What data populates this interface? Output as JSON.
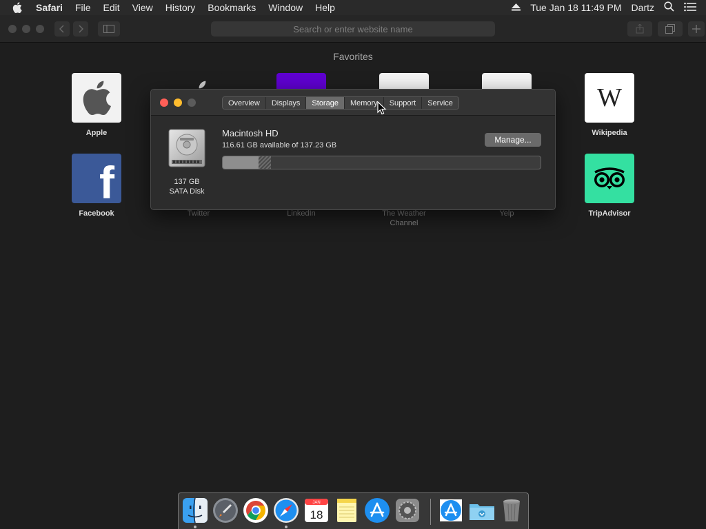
{
  "menubar": {
    "app_name": "Safari",
    "items": [
      "File",
      "Edit",
      "View",
      "History",
      "Bookmarks",
      "Window",
      "Help"
    ],
    "datetime": "Tue Jan 18  11:49 PM",
    "user": "Dartz"
  },
  "toolbar": {
    "address_placeholder": "Search or enter website name"
  },
  "favorites": {
    "heading": "Favorites",
    "items": [
      {
        "label": "Apple",
        "icon": "apple-logo-icon"
      },
      {
        "label": "Wikipedia",
        "icon": "wikipedia-w-icon"
      },
      {
        "label": "Facebook",
        "icon": "facebook-f-icon"
      },
      {
        "label": "Twitter",
        "icon": "twitter-icon"
      },
      {
        "label": "LinkedIn",
        "icon": "linkedin-icon"
      },
      {
        "label": "The Weather Channel",
        "icon": "weather-channel-icon"
      },
      {
        "label": "Yelp",
        "icon": "yelp-icon"
      },
      {
        "label": "TripAdvisor",
        "icon": "tripadvisor-owl-icon"
      }
    ]
  },
  "about": {
    "tabs": [
      "Overview",
      "Displays",
      "Storage",
      "Memory",
      "Support",
      "Service"
    ],
    "active_tab": "Storage",
    "disk_size": "137 GB",
    "disk_type": "SATA Disk",
    "volume_name": "Macintosh HD",
    "volume_available": "116.61 GB available of 137.23 GB",
    "manage_label": "Manage...",
    "used_fraction": 0.113,
    "purgeable_fraction": 0.038
  },
  "dock": {
    "apps": [
      "Finder",
      "Launchpad",
      "Google Chrome",
      "Safari",
      "Calendar",
      "Notes",
      "App Store",
      "System Preferences",
      "App Store Downloads",
      "Downloads",
      "Trash"
    ],
    "calendar_month": "JAN",
    "calendar_day": "18"
  },
  "colors": {
    "accent_red": "#ff5f57",
    "accent_yellow": "#febc2e",
    "facebook_blue": "#3b5998",
    "tripadvisor_green": "#34e0a1"
  }
}
